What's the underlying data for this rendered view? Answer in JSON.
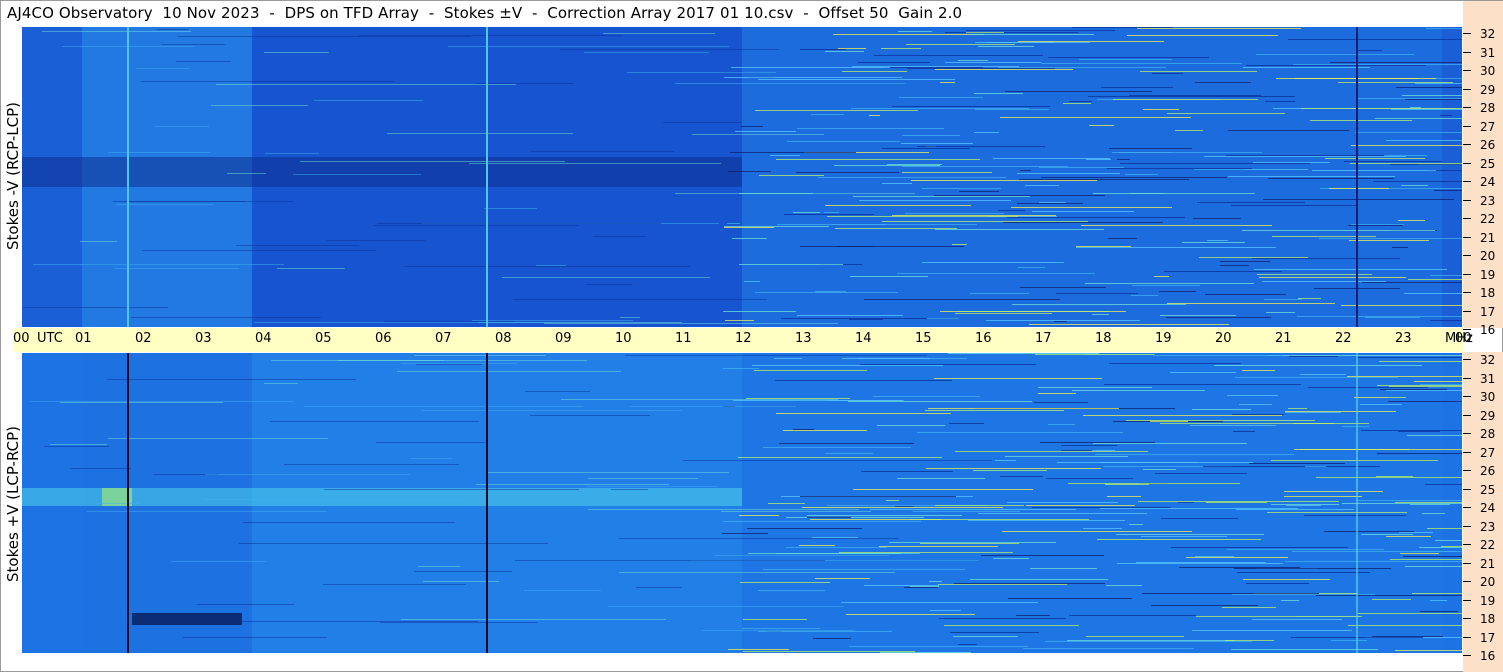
{
  "title": "AJ4CO Observatory  10 Nov 2023  -  DPS on TFD Array  -  Stokes ±V  -  Correction Array 2017 01 10.csv  -  Offset 50  Gain 2.0",
  "panels": {
    "top": {
      "ylabel": "Stokes -V (RCP-LCP)"
    },
    "bottom": {
      "ylabel": "Stokes +V (LCP-RCP)"
    }
  },
  "time_axis": {
    "ticks": [
      "00",
      "UTC",
      "01",
      "02",
      "03",
      "04",
      "05",
      "06",
      "07",
      "08",
      "09",
      "10",
      "11",
      "12",
      "13",
      "14",
      "15",
      "16",
      "17",
      "18",
      "19",
      "20",
      "21",
      "22",
      "23",
      "00",
      "MHz"
    ]
  },
  "freq_axis": {
    "labels": [
      "32",
      "31",
      "30",
      "29",
      "28",
      "27",
      "26",
      "25",
      "24",
      "23",
      "22",
      "21",
      "20",
      "19",
      "18",
      "17",
      "16"
    ]
  },
  "colors": {
    "spectrogram_base": "#1a5ad8",
    "time_axis_bg": "#ffffc4",
    "freq_axis_bg": "#fde0c8"
  }
}
